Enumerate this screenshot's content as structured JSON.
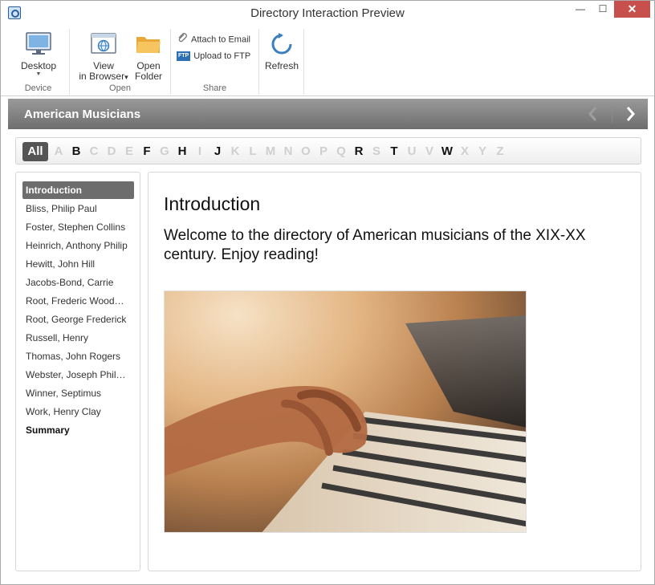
{
  "window": {
    "title": "Directory Interaction Preview",
    "minimize": "—",
    "maximize": "☐",
    "close": "✕"
  },
  "ribbon": {
    "groups": {
      "device": {
        "label": "Device",
        "desktop_label": "Desktop",
        "desktop_arrow": "▼"
      },
      "open": {
        "label": "Open",
        "view_line1": "View",
        "view_line2": "in Browser",
        "view_arrow": "▾",
        "open_line1": "Open",
        "open_line2": "Folder"
      },
      "share": {
        "label": "Share",
        "attach_email": "Attach to Email",
        "upload_ftp": "Upload to FTP",
        "ftp_badge": "FTP"
      },
      "refresh": {
        "label": "Refresh"
      }
    }
  },
  "header": {
    "title": "American Musicians"
  },
  "letters": {
    "all_label": "All",
    "items": [
      {
        "l": "A",
        "active": false
      },
      {
        "l": "B",
        "active": true
      },
      {
        "l": "C",
        "active": false
      },
      {
        "l": "D",
        "active": false
      },
      {
        "l": "E",
        "active": false
      },
      {
        "l": "F",
        "active": true
      },
      {
        "l": "G",
        "active": false
      },
      {
        "l": "H",
        "active": true
      },
      {
        "l": "I",
        "active": false
      },
      {
        "l": "J",
        "active": true
      },
      {
        "l": "K",
        "active": false
      },
      {
        "l": "L",
        "active": false
      },
      {
        "l": "M",
        "active": false
      },
      {
        "l": "N",
        "active": false
      },
      {
        "l": "O",
        "active": false
      },
      {
        "l": "P",
        "active": false
      },
      {
        "l": "Q",
        "active": false
      },
      {
        "l": "R",
        "active": true
      },
      {
        "l": "S",
        "active": false
      },
      {
        "l": "T",
        "active": true
      },
      {
        "l": "U",
        "active": false
      },
      {
        "l": "V",
        "active": false
      },
      {
        "l": "W",
        "active": true
      },
      {
        "l": "X",
        "active": false
      },
      {
        "l": "Y",
        "active": false
      },
      {
        "l": "Z",
        "active": false
      }
    ]
  },
  "sidebar": {
    "items": [
      "Introduction",
      "Bliss, Philip Paul",
      "Foster, Stephen Collins",
      "Heinrich, Anthony Philip",
      "Hewitt, John Hill",
      "Jacobs-Bond, Carrie",
      "Root, Frederic Wood…",
      "Root, George Frederick",
      "Russell, Henry",
      "Thomas, John Rogers",
      "Webster, Joseph Phil…",
      "Winner, Septimus",
      "Work, Henry Clay",
      "Summary"
    ]
  },
  "content": {
    "title": "Introduction",
    "text": "Welcome to the directory of American musicians of the XIX-XX century. Enjoy reading!"
  },
  "colors": {
    "header_band": "#7f7f7f",
    "selected_item": "#6d6d6d",
    "close_button": "#c7504d",
    "refresh_icon": "#3a7fc0"
  }
}
